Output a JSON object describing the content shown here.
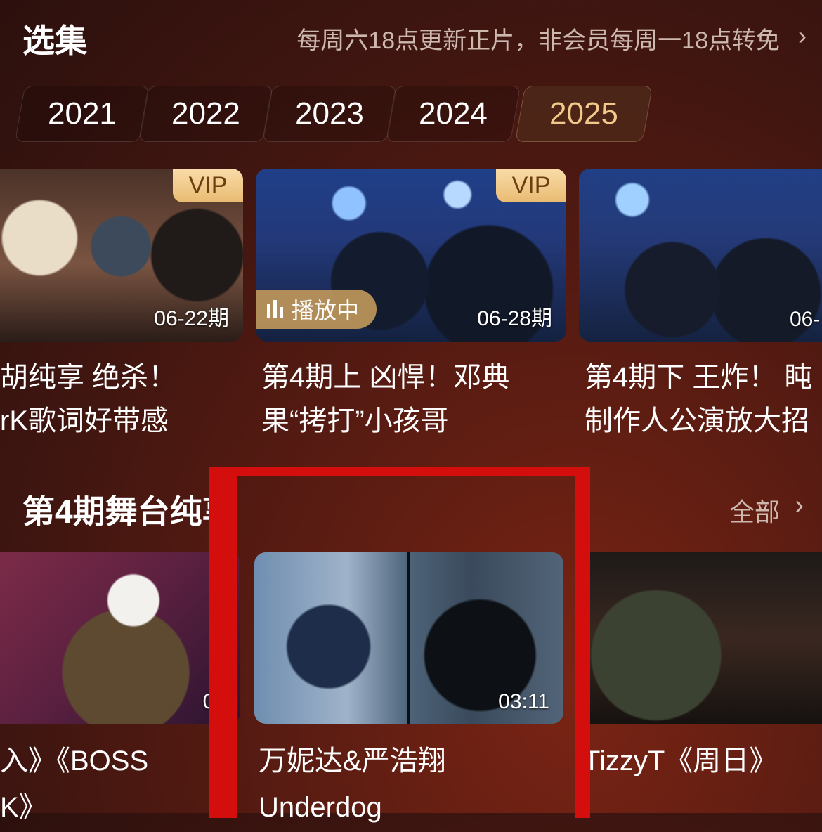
{
  "header": {
    "title": "选集",
    "schedule_note": "每周六18点更新正片，非会员每周一18点转免",
    "chevron_icon": "chevron-right-icon"
  },
  "years": [
    {
      "label": "2021",
      "selected": false
    },
    {
      "label": "2022",
      "selected": false
    },
    {
      "label": "2023",
      "selected": false
    },
    {
      "label": "2024",
      "selected": false
    },
    {
      "label": "2025",
      "selected": true
    }
  ],
  "episodes": [
    {
      "badge": "VIP",
      "date": "06-22期",
      "title_line1": "胡纯享 绝杀！",
      "title_line2": "rK歌词好带感"
    },
    {
      "badge": "VIP",
      "playing_label": "播放中",
      "date": "06-28期",
      "title_line1": "第4期上 凶悍！邓典",
      "title_line2": "果“拷打”小孩哥"
    },
    {
      "date": "06-",
      "title_line1": "第4期下 王炸！ 盹",
      "title_line2": "制作人公演放大招"
    }
  ],
  "section": {
    "title": "第4期舞台纯享",
    "all_label": "全部"
  },
  "clips": [
    {
      "duration": "04",
      "title_line1": "入》《BOSS",
      "title_line2": "K》"
    },
    {
      "duration": "03:11",
      "title_line1": "万妮达&严浩翔",
      "title_line2": "Underdog"
    },
    {
      "title_line1": "TizzyT《周日》"
    }
  ],
  "colors": {
    "background": "#4a1812",
    "accent_gold": "#f3c88b",
    "vip_badge": "#efc781",
    "annotation_red": "#d40d0d"
  }
}
